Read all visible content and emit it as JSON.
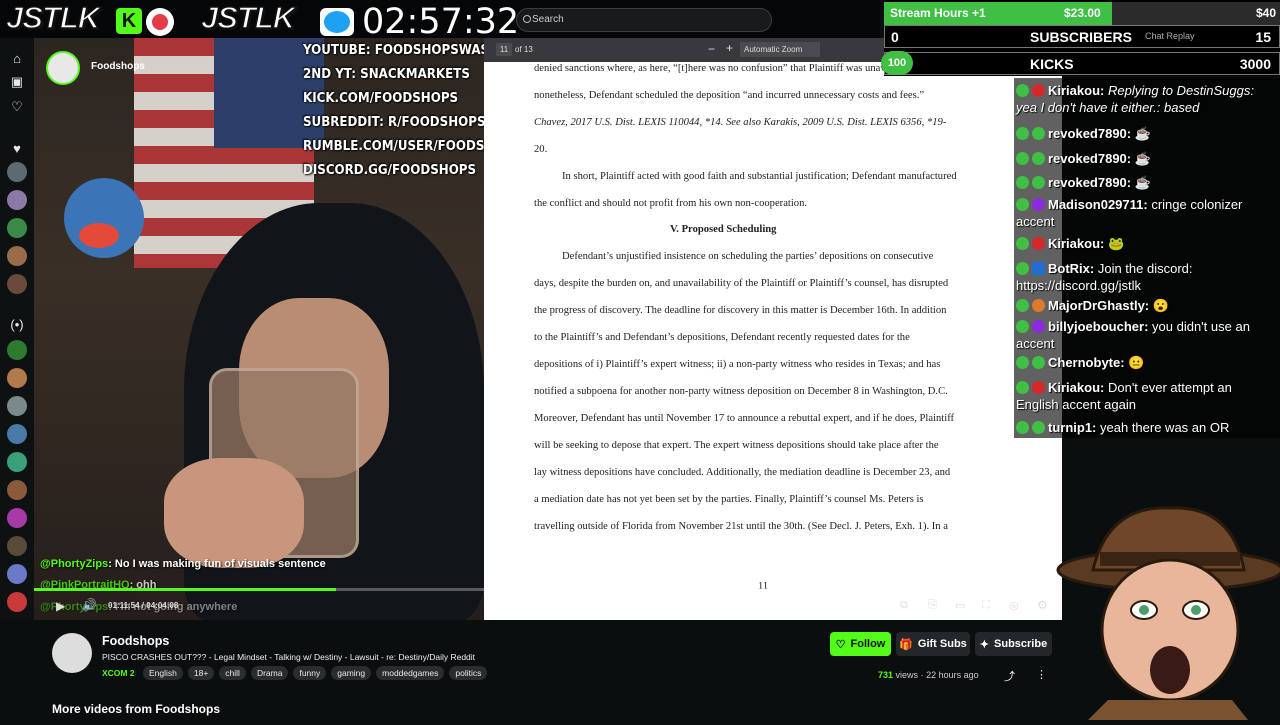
{
  "topbar": {
    "logo_left": "JSTLK",
    "logo_right": "JSTLK",
    "clock": "02:57:32",
    "search_placeholder": "Search"
  },
  "socials": [
    "YOUTUBE: FOODSHOPSWASTAKEN",
    "2ND YT: SNACKMARKETS",
    "KICK.COM/FOODSHOPS",
    "SUBREDDIT: R/FOODSHOPS",
    "RUMBLE.COM/USER/FOODSHOPS",
    "DISCORD.GG/FOODSHOPS"
  ],
  "webcam": {
    "channel_label": "Foodshops"
  },
  "pdf_toolbar": {
    "page": "11",
    "page_total": "of 13",
    "zoom": "Automatic Zoom"
  },
  "document": {
    "lines": [
      "denied sanctions where, as here, “[t]here was no confusion” that Plaintiff was unavailable, but",
      "nonetheless, Defendant scheduled the deposition “and incurred unnecessary costs and fees.”",
      "Chavez, 2017 U.S. Dist. LEXIS 110044, *14. See also Karakis, 2009 U.S. Dist. LEXIS 6356, *19-",
      "20.",
      "In short, Plaintiff acted with good faith and substantial justification; Defendant manufactured",
      "the conflict and should not profit from his own non-cooperation.",
      "V.      Proposed Scheduling",
      "Defendant’s unjustified insistence on scheduling the parties’ depositions on consecutive",
      "days, despite the burden on, and unavailability of the Plaintiff or Plaintiff’s counsel, has disrupted",
      "the progress of discovery. The deadline for discovery in this matter is December 16th. In addition",
      "to the Plaintiff’s and Defendant’s depositions, Defendant recently requested dates for the",
      "depositions of i) Plaintiff’s expert witness; ii) a non-party witness who resides in Texas; and has",
      "notified a subpoena for another non-party witness deposition on December 8 in Washington, D.C.",
      "Moreover, Defendant has until November 17 to announce a rebuttal expert, and if he does, Plaintiff",
      "will be seeking to depose that expert. The expert witness depositions should take place after the",
      "lay witness depositions have concluded. Additionally, the mediation deadline is December 23, and",
      "a mediation date has not yet been set by the parties. Finally, Plaintiff’s counsel Ms. Peters is",
      "travelling outside of Florida from November 21st until the 30th. (See Decl. J. Peters, Exh. 1). In a"
    ],
    "page_number": "11"
  },
  "goals": {
    "stream_hours_label": "Stream Hours +1",
    "stream_hours_current": "$23.00",
    "stream_hours_target": "$40",
    "stream_hours_progress": 0.575,
    "subs_start": "0",
    "subs_label": "SUBSCRIBERS",
    "subs_target": "15",
    "kicks_start": "100",
    "kicks_label": "KICKS",
    "kicks_target": "3000",
    "replay_label": "Chat Replay"
  },
  "chat": [
    {
      "user": "Kiriakou:",
      "text": "Replying to DestinSuggs: yea I don't have it either.: based",
      "color": "#ffffff"
    },
    {
      "user": "revoked7890:",
      "text": "",
      "color": "#ffffff"
    },
    {
      "user": "revoked7890:",
      "text": "",
      "color": "#ffffff"
    },
    {
      "user": "revoked7890:",
      "text": "",
      "color": "#ffffff"
    },
    {
      "user": "Madison029711:",
      "text": "cringe colonizer accent",
      "color": "#ffffff"
    },
    {
      "user": "Kiriakou:",
      "text": "",
      "color": "#ffffff"
    },
    {
      "user": "BotRix:",
      "text": "Join the discord: https://discord.gg/jstlk",
      "color": "#ffffff"
    },
    {
      "user": "MajorDrGhastly:",
      "text": "",
      "color": "#ffffff"
    },
    {
      "user": "billyjoeboucher:",
      "text": "you didn't use an accent",
      "color": "#ffffff"
    },
    {
      "user": "Chernobyte:",
      "text": "",
      "color": "#ffffff"
    },
    {
      "user": "Kiriakou:",
      "text": "Don't ever attempt an English accent again",
      "color": "#ffffff"
    },
    {
      "user": "turnip1:",
      "text": "yeah there was an OR",
      "color": "#ffffff"
    }
  ],
  "overlay_chat": [
    {
      "user": "@PhortyZips",
      "text": ": No I was making fun of visuals sentence"
    },
    {
      "user": "@PinkPortraitHQ",
      "text": ": ohh"
    },
    {
      "user": "@PhortyZips",
      "text": ": I'm not going anywhere"
    }
  ],
  "player": {
    "time": "01:11:54 / 04:04:08",
    "progress": 0.294
  },
  "info": {
    "channel": "Foodshops",
    "title": "PISCO CRASHES OUT??? - Legal Mindset - Talking w/ Destiny - Lawsuit - re: Destiny/Daily Reddit",
    "category": "XCOM 2",
    "tags": [
      "English",
      "18+",
      "chill",
      "Drama",
      "funny",
      "gaming",
      "moddedgames",
      "politics"
    ],
    "follow": "Follow",
    "gift_subs": "Gift Subs",
    "subscribe": "Subscribe",
    "views_count": "731",
    "views_label": "views",
    "time_ago": "22 hours ago",
    "more_videos": "More videos from Foodshops"
  },
  "colors": {
    "kick_green": "#53fc18",
    "background": "#0b0e0f"
  }
}
